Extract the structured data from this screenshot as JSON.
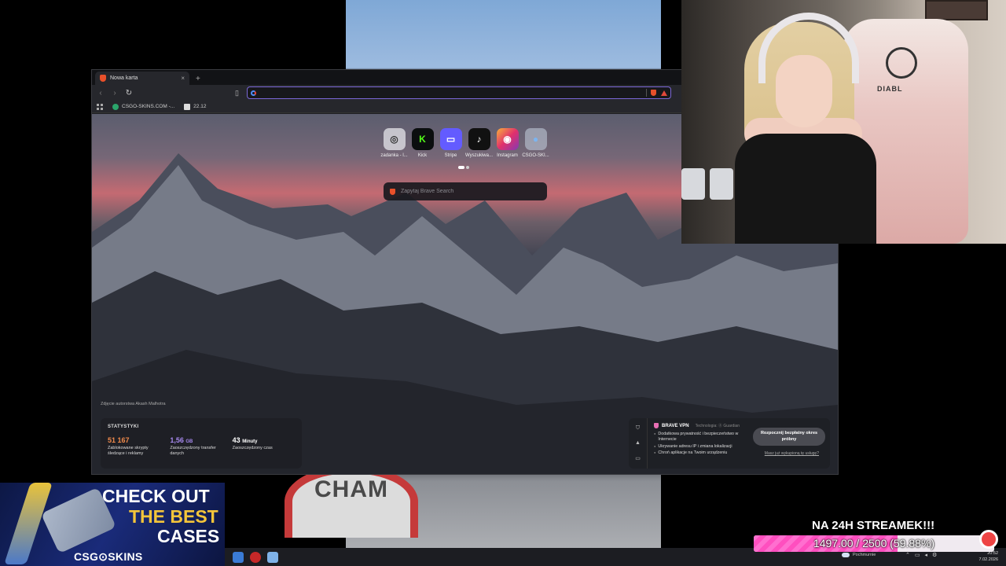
{
  "background_sign": {
    "text": "CHAM"
  },
  "browser": {
    "tab": {
      "title": "Nowa karta",
      "close": "×"
    },
    "new_tab": "+",
    "nav": {
      "back": "‹",
      "forward": "›",
      "reload": "↻",
      "bookmark": "🔖"
    },
    "address": {
      "value": ""
    },
    "bookmarks": [
      {
        "label": "CSGO-SKINS.COM -..."
      },
      {
        "label": "22.12"
      }
    ]
  },
  "newtab": {
    "shortcuts": [
      {
        "label": "zadanka - l...",
        "glyph": "◎",
        "color": "#ffffff"
      },
      {
        "label": "Kick",
        "glyph": "K",
        "color": "#53fc18"
      },
      {
        "label": "Stripe",
        "glyph": "▭",
        "color": "#635bff"
      },
      {
        "label": "Wyszukiwa...",
        "glyph": "♪",
        "color": "#111111"
      },
      {
        "label": "Instagram",
        "glyph": "◉",
        "color": "#e1306c"
      },
      {
        "label": "CSGO-SKI...",
        "glyph": "●",
        "color": "#7cb5f0"
      }
    ],
    "search_placeholder": "Zapytaj Brave Search",
    "photo_credit": "Zdjęcie autorstwa Akash Malhotra",
    "stats": {
      "header": "STATYSTYKI",
      "items": [
        {
          "value": "51 167",
          "unit": "",
          "desc": "Zablokowane skrypty śledzące i reklamy",
          "color": "#f08a4b"
        },
        {
          "value": "1,56",
          "unit": "GB",
          "desc": "Zaoszczędzony transfer danych",
          "color": "#a88af0"
        },
        {
          "value": "43",
          "unit": "Minuty",
          "desc": "Zaoszczędzony czas",
          "color": "#ffffff"
        }
      ]
    },
    "vpn": {
      "title": "BRAVE VPN",
      "tech": "Technologia: ⓖ Guardian",
      "features": [
        "Dodatkowa prywatność i bezpieczeństwo w Internecie",
        "Ukrywanie adresu IP i zmiana lokalizacji",
        "Chroń aplikacje na Twoim urządzeniu"
      ],
      "cta": "Rozpocznij bezpłatny okres próbny",
      "link": "Masz już wykupioną tę usługę?"
    }
  },
  "webcam": {
    "chair_text": "DIABL"
  },
  "promo": {
    "line1": "CHECK OUT",
    "line2": "THE BEST",
    "line3": "CASES",
    "brand": "CSG⊙SKINS"
  },
  "taskbar": {
    "weather": "Pochmurnie",
    "time": "20:52",
    "date": "7.02.2026"
  },
  "goal": {
    "title": "NA 24H STREAMEK!!!",
    "text": "1497.00 / 2500 (59.88%)",
    "current": 1497.0,
    "target": 2500,
    "percent": 59.88
  }
}
